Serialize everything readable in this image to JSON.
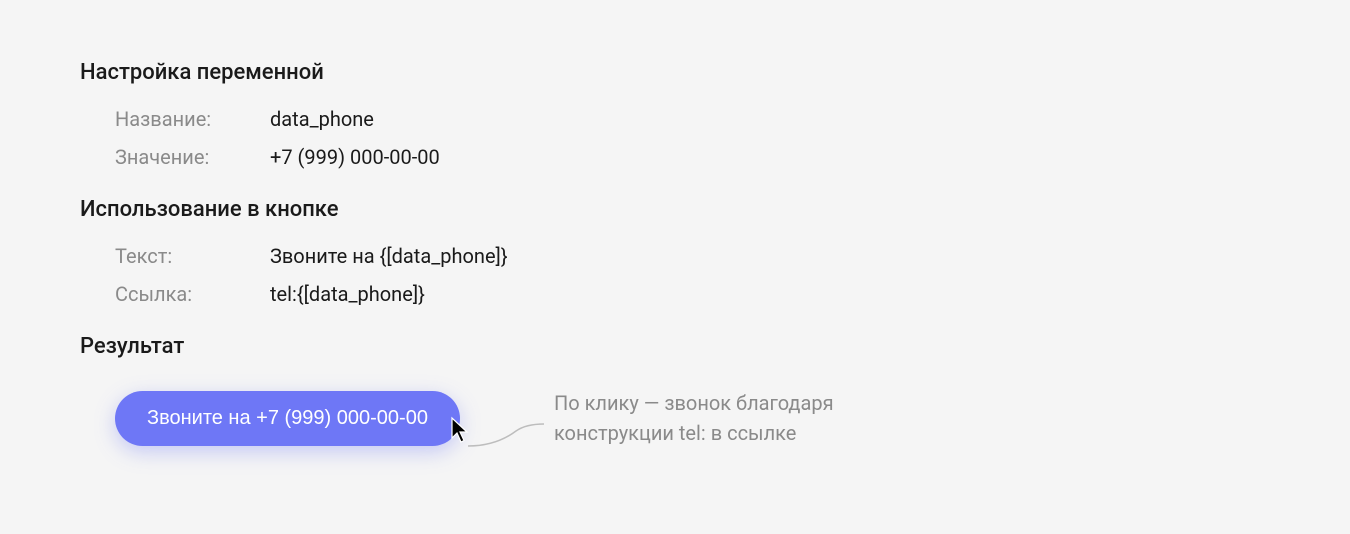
{
  "variable": {
    "heading": "Настройка переменной",
    "name_label": "Название:",
    "name_value": "data_phone",
    "value_label": "Значение:",
    "value_value": "+7 (999) 000-00-00"
  },
  "usage": {
    "heading": "Использование в кнопке",
    "text_label": "Текст:",
    "text_value": "Звоните на {[data_phone]}",
    "link_label": "Ссылка:",
    "link_value": "tel:{[data_phone]}"
  },
  "result": {
    "heading": "Результат",
    "button_label": "Звоните на +7 (999) 000-00-00",
    "note": "По клику — звонок благодаря конструкции tel: в ссылке"
  }
}
